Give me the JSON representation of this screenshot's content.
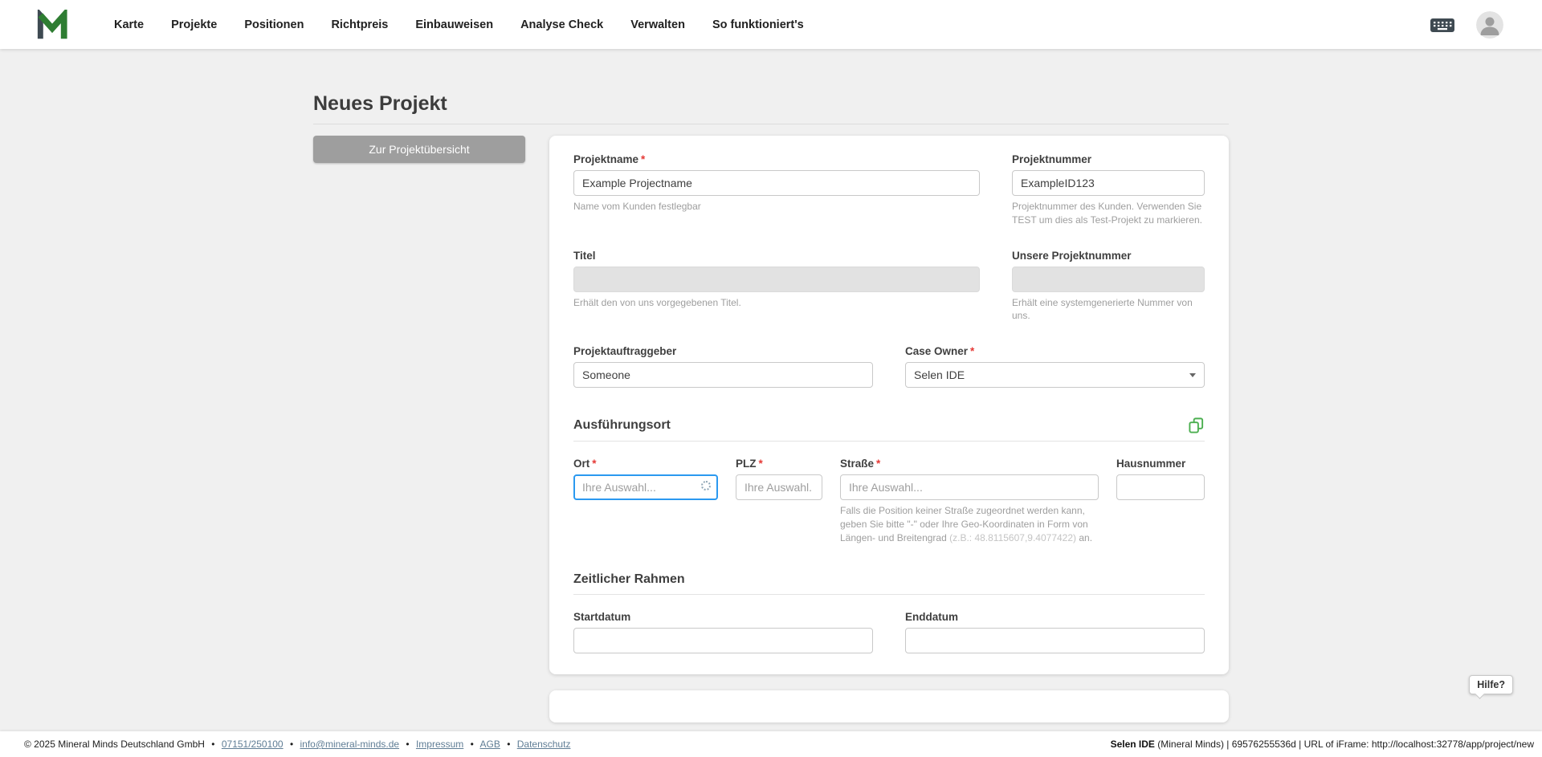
{
  "nav": {
    "items": [
      "Karte",
      "Projekte",
      "Positionen",
      "Richtpreis",
      "Einbauweisen",
      "Analyse Check",
      "Verwalten",
      "So funktioniert's"
    ]
  },
  "page": {
    "title": "Neues Projekt",
    "back_button": "Zur Projektübersicht"
  },
  "form": {
    "projektname": {
      "label": "Projektname",
      "required": "*",
      "value": "Example Projectname",
      "helper": "Name vom Kunden festlegbar"
    },
    "projektnummer": {
      "label": "Projektnummer",
      "value": "ExampleID123",
      "helper": "Projektnummer des Kunden. Verwenden Sie TEST um dies als Test-Projekt zu markieren."
    },
    "titel": {
      "label": "Titel",
      "value": "",
      "helper": "Erhält den von uns vorgegebenen Titel."
    },
    "unsere_projektnummer": {
      "label": "Unsere Projektnummer",
      "value": "",
      "helper": "Erhält eine systemgenerierte Nummer von uns."
    },
    "projektauftraggeber": {
      "label": "Projektauftraggeber",
      "value": "Someone"
    },
    "case_owner": {
      "label": "Case Owner",
      "required": "*",
      "value": "Selen IDE"
    },
    "section_ausfuehrungsort": "Ausführungsort",
    "section_zeitlicher_rahmen": "Zeitlicher Rahmen",
    "ort": {
      "label": "Ort",
      "required": "*",
      "placeholder": "Ihre Auswahl..."
    },
    "plz": {
      "label": "PLZ",
      "required": "*",
      "placeholder": "Ihre Auswahl."
    },
    "strasse": {
      "label": "Straße",
      "required": "*",
      "placeholder": "Ihre Auswahl...",
      "helper_main": "Falls die Position keiner Straße zugeordnet werden kann, geben Sie bitte \"-\" oder Ihre Geo-Koordinaten in Form von Längen- und Breitengrad ",
      "helper_example": "(z.B.: 48.8115607,9.4077422)",
      "helper_suffix": " an."
    },
    "hausnummer": {
      "label": "Hausnummer"
    },
    "startdatum": {
      "label": "Startdatum"
    },
    "enddatum": {
      "label": "Enddatum"
    }
  },
  "help": {
    "label": "Hilfe?"
  },
  "footer": {
    "copyright": "© 2025 Mineral Minds Deutschland GmbH",
    "sep": "•",
    "phone": "07151/250100",
    "email": "info@mineral-minds.de",
    "impressum": "Impressum",
    "agb": "AGB",
    "datenschutz": "Datenschutz",
    "user": "Selen IDE",
    "session": " (Mineral Minds) | 69576255536d | URL of iFrame: http://localhost:32778/app/project/new"
  },
  "colors": {
    "brand_green": "#2e7d32",
    "icon_green": "#4caf50",
    "focus_blue": "#2b99f0",
    "required_red": "#e53935",
    "button_gray": "#9e9e9e"
  }
}
